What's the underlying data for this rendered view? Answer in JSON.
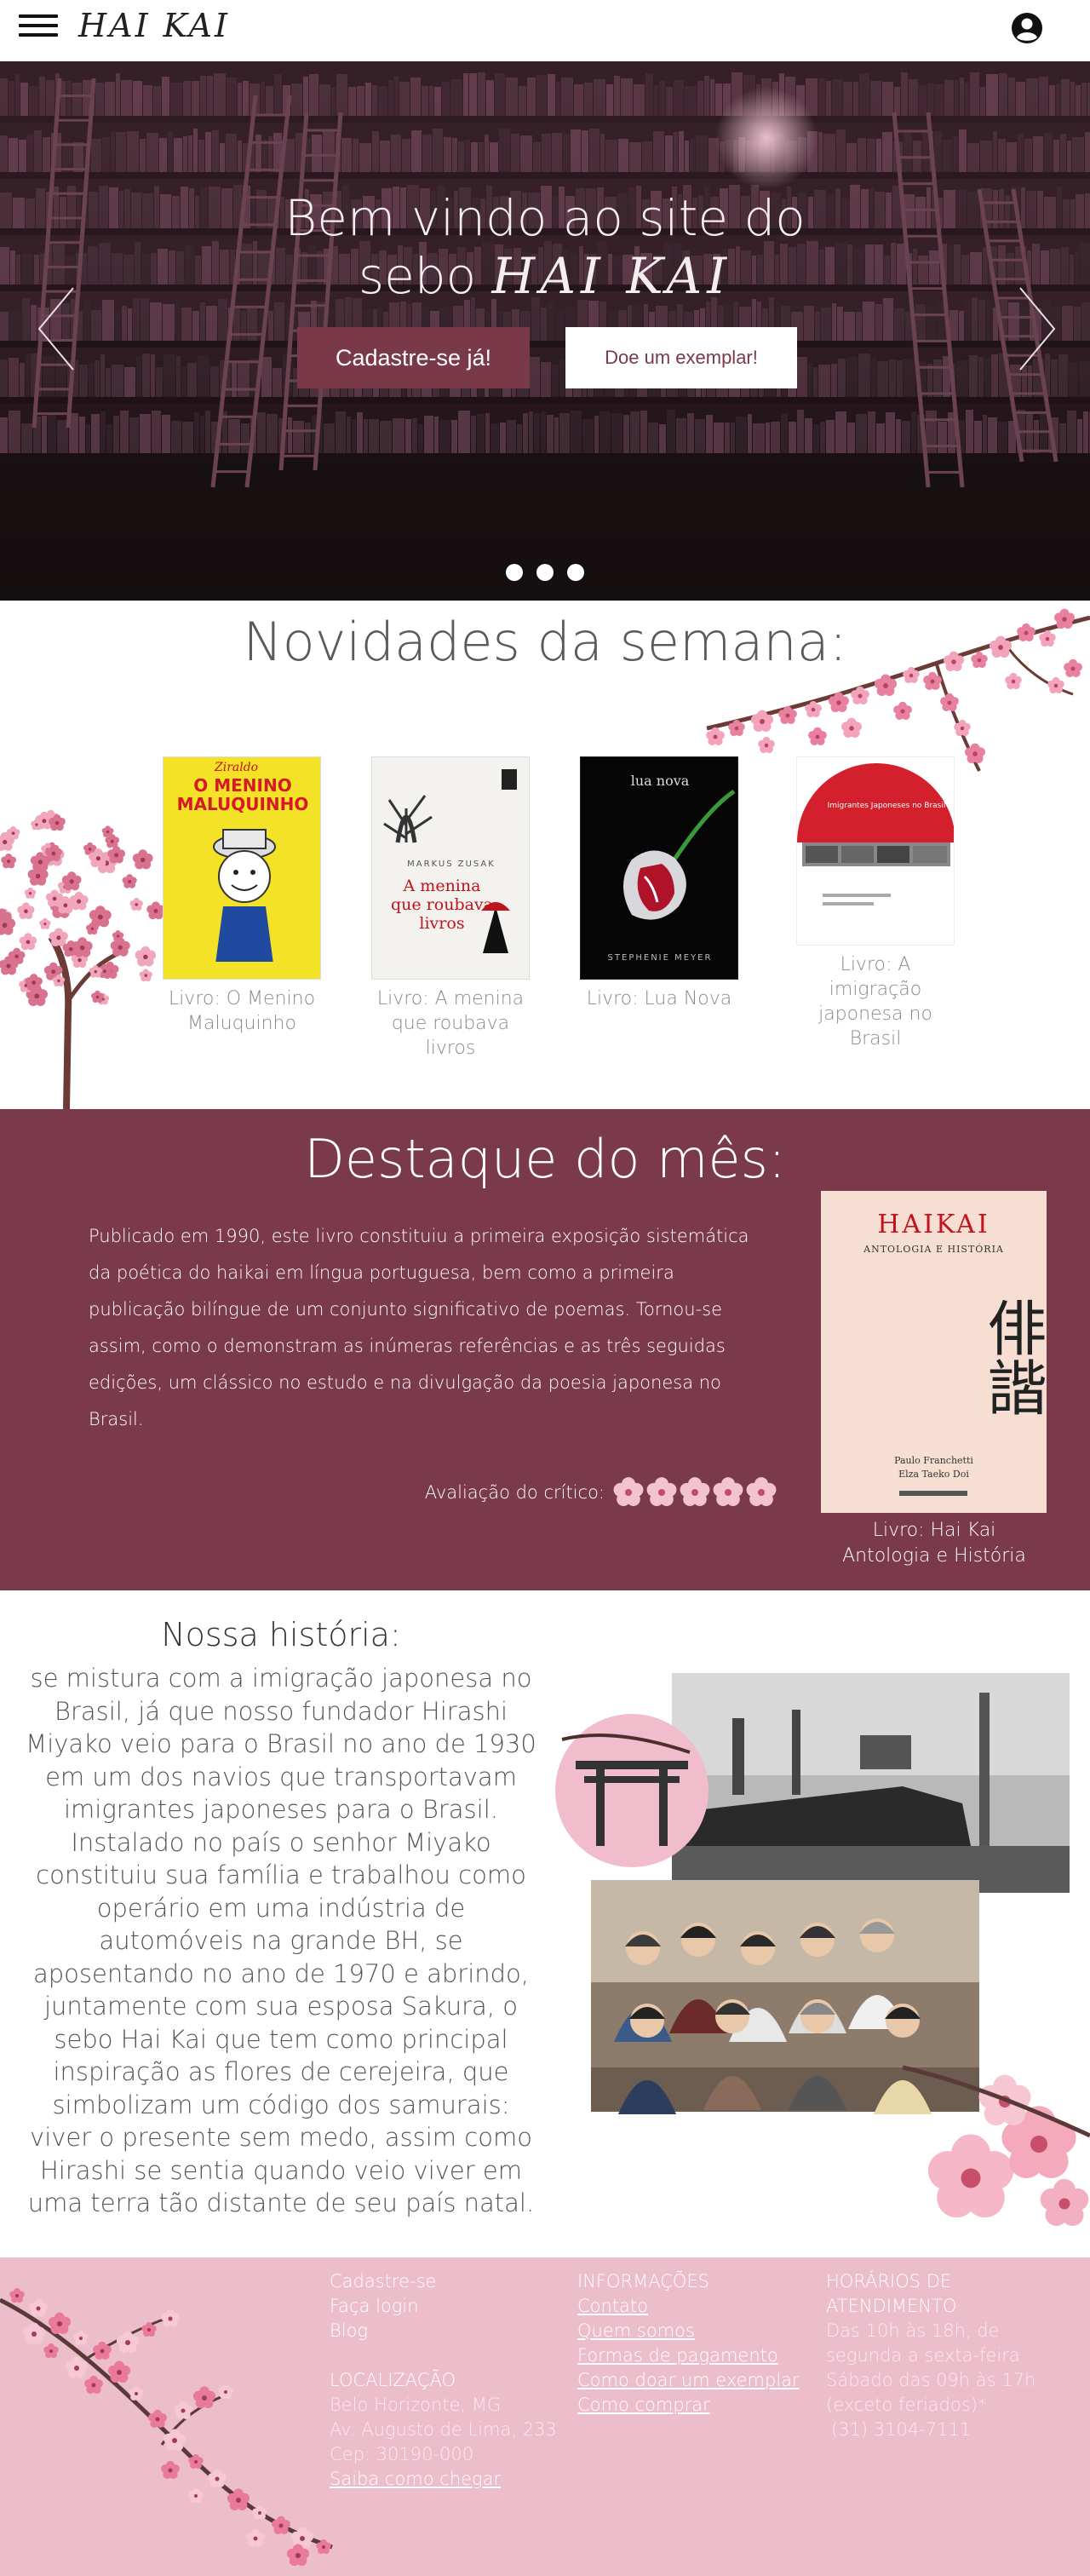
{
  "header": {
    "logo": "HAI KAI",
    "menu_icon": "hamburger-menu-icon",
    "user_icon": "user-account-icon"
  },
  "hero": {
    "title_line1": "Bem vindo ao site do",
    "title_line2_prefix": "sebo",
    "title_brand": "HAI KAI",
    "register_button": "Cadastre-se já!",
    "donate_button": "Doe um exemplar!",
    "prev_icon": "chevron-left-icon",
    "next_icon": "chevron-right-icon",
    "slides_count": 3
  },
  "novidades": {
    "title": "Novidades da semana:",
    "books": [
      {
        "caption": "Livro: O Menino Maluquinho",
        "cover_title": "O MENINO MALUQUINHO",
        "cover_author": "Ziraldo"
      },
      {
        "caption": "Livro: A menina que roubava livros",
        "cover_title": "A menina que roubava livros",
        "cover_author": "MARKUS ZUSAK"
      },
      {
        "caption": "Livro: Lua Nova",
        "cover_title": "lua nova",
        "cover_author": "STEPHENIE MEYER"
      },
      {
        "caption": "Livro: A imigração japonesa no Brasil",
        "cover_title": "Imigrantes Japoneses no Brasil"
      }
    ]
  },
  "destaque": {
    "title": "Destaque do mês:",
    "text": "Publicado em 1990, este livro constituiu a primeira exposição sistemática da poética do haikai em língua portuguesa, bem como a primeira publicação bilíngue de um conjunto significativo de poemas. Tornou-se assim, como o demonstram as inúmeras referências e as três seguidas edições, um clássico no estudo e na divulgação da poesia japonesa no Brasil.",
    "rating_label": "Avaliação do crítico:",
    "rating_value": 5,
    "rating_max": 5,
    "rating_icon": "cherry-blossom-icon",
    "cover_title": "HAIKAI",
    "cover_subtitle": "ANTOLOGIA E HISTÓRIA",
    "cover_kanji": "俳諧",
    "cover_authors": [
      "Paulo Franchetti",
      "Elza Taeko Doi"
    ],
    "caption_line1": "Livro: Hai Kai",
    "caption_line2": "Antologia e História"
  },
  "historia": {
    "title": "Nossa história:",
    "text": "se mistura com a imigração japonesa no Brasil, já que nosso fundador Hirashi Miyako veio para o Brasil no ano de 1930 em um dos navios que transportavam imigrantes japoneses para o Brasil. Instalado no país o senhor Miyako constituiu sua família e trabalhou como operário em uma indústria de automóveis na grande BH, se aposentando no ano de 1970 e abrindo, juntamente com sua esposa Sakura, o sebo Hai Kai que tem como principal inspiração as flores de cerejeira, que simbolizam um código dos samurais: viver o presente sem medo, assim como Hirashi se sentia quando veio viver em uma terra tão distante de seu país natal."
  },
  "footer": {
    "account": {
      "signup": "Cadastre-se",
      "login": "Faça login",
      "blog": "Blog"
    },
    "location": {
      "head": "LOCALIZAÇÃO",
      "city": "Belo Horizonte, MG",
      "street": "Av. Augusto de Lima, 233",
      "zip": "Cep: 30190-000",
      "directions": "Saiba como chegar"
    },
    "info": {
      "head": "INFORMAÇÕES",
      "links": [
        "Contato",
        "Quem somos",
        "Formas de pagamento",
        "Como doar um exemplar",
        "Como comprar"
      ]
    },
    "hours": {
      "head_line1": "HORÁRIOS DE",
      "head_line2": "ATENDIMENTO",
      "line1": "Das 10h às 18h, de",
      "line2": "segunda a sexta-feira",
      "line3": "Sábado das 09h às 17h",
      "line4": "(exceto feriados)*",
      "phone": "(31) 3104-7111"
    }
  },
  "colors": {
    "accent": "#7b3a4b",
    "footer_bg": "#ecbdcb",
    "blossom": "#e88aa6"
  }
}
